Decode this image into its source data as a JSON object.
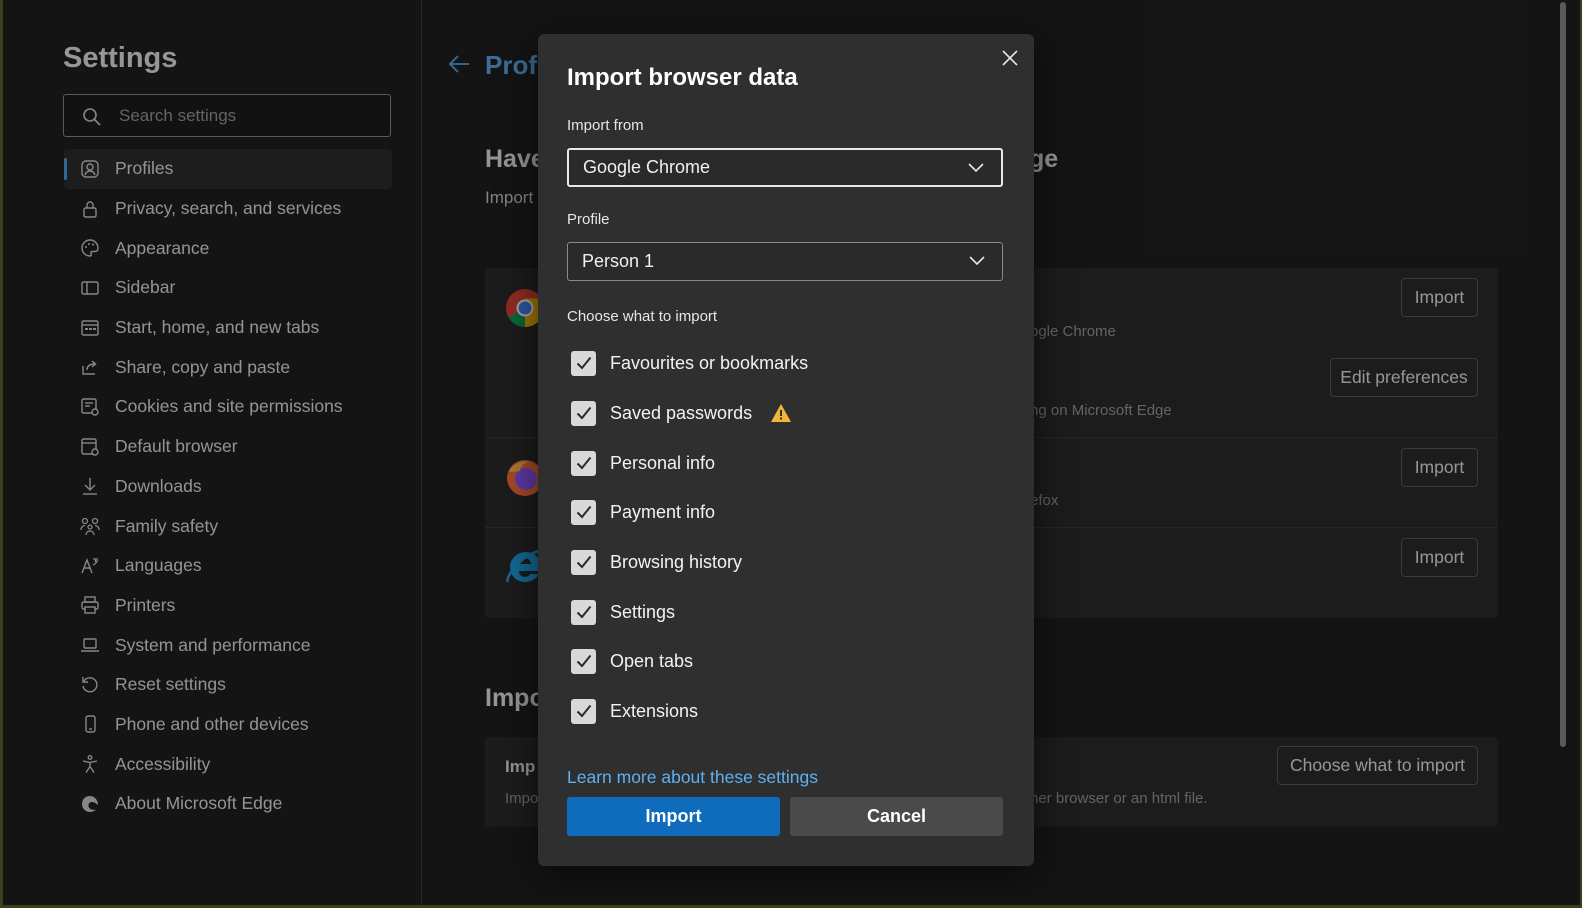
{
  "sidebar": {
    "title": "Settings",
    "search_placeholder": "Search settings",
    "items": [
      {
        "label": "Profiles",
        "icon": "profile-icon",
        "active": true
      },
      {
        "label": "Privacy, search, and services",
        "icon": "lock-icon"
      },
      {
        "label": "Appearance",
        "icon": "palette-icon"
      },
      {
        "label": "Sidebar",
        "icon": "sidebar-icon"
      },
      {
        "label": "Start, home, and new tabs",
        "icon": "home-tabs-icon"
      },
      {
        "label": "Share, copy and paste",
        "icon": "share-icon"
      },
      {
        "label": "Cookies and site permissions",
        "icon": "cookies-icon"
      },
      {
        "label": "Default browser",
        "icon": "default-browser-icon"
      },
      {
        "label": "Downloads",
        "icon": "download-icon"
      },
      {
        "label": "Family safety",
        "icon": "family-icon"
      },
      {
        "label": "Languages",
        "icon": "languages-icon"
      },
      {
        "label": "Printers",
        "icon": "printer-icon"
      },
      {
        "label": "System and performance",
        "icon": "laptop-icon"
      },
      {
        "label": "Reset settings",
        "icon": "reset-icon"
      },
      {
        "label": "Phone and other devices",
        "icon": "phone-icon"
      },
      {
        "label": "Accessibility",
        "icon": "accessibility-icon"
      },
      {
        "label": "About Microsoft Edge",
        "icon": "edge-icon"
      }
    ]
  },
  "main": {
    "breadcrumb": "Profi",
    "section1_heading_start": "Have",
    "section1_heading_end": "ge",
    "section1_sub": "Import",
    "chrome_row": {
      "import_label": "Import",
      "desc": "ogle Chrome",
      "edit_label": "Edit preferences",
      "desc2": "ng on Microsoft Edge"
    },
    "firefox_row": {
      "import_label": "Import",
      "desc": "efox"
    },
    "ie_row": {
      "import_label": "Import"
    },
    "section2_heading": "Impo",
    "card2": {
      "title": "Imp",
      "sub_start": "Impo",
      "sub_end": "her browser or an html file.",
      "choose_label": "Choose what to import"
    }
  },
  "dialog": {
    "title": "Import browser data",
    "import_from_label": "Import from",
    "import_from_value": "Google Chrome",
    "profile_label": "Profile",
    "profile_value": "Person 1",
    "choose_label": "Choose what to import",
    "options": [
      {
        "label": "Favourites or bookmarks",
        "checked": true
      },
      {
        "label": "Saved passwords",
        "checked": true,
        "warning": true
      },
      {
        "label": "Personal info",
        "checked": true
      },
      {
        "label": "Payment info",
        "checked": true
      },
      {
        "label": "Browsing history",
        "checked": true
      },
      {
        "label": "Settings",
        "checked": true
      },
      {
        "label": "Open tabs",
        "checked": true
      },
      {
        "label": "Extensions",
        "checked": true
      }
    ],
    "learn_more": "Learn more about these settings",
    "import_button": "Import",
    "cancel_button": "Cancel"
  },
  "colors": {
    "accent": "#0f6cbd",
    "link": "#5fb0f0",
    "warning": "#f2b53a"
  }
}
